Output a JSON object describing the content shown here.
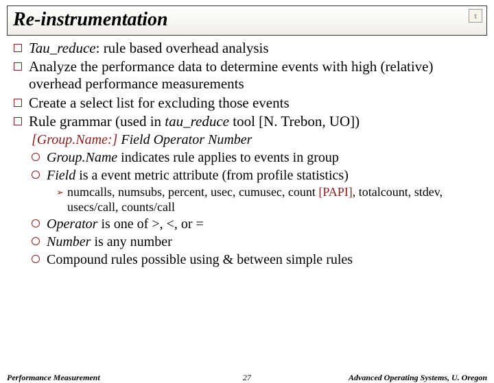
{
  "title": "Re-instrumentation",
  "logo_glyph": "τ",
  "bullets": [
    {
      "pre_italic": "Tau_reduce",
      "post": ": rule based overhead analysis"
    },
    {
      "text": "Analyze the performance data to determine events with high (relative) overhead performance measurements"
    },
    {
      "text": "Create a select list for excluding those events"
    },
    {
      "pre": "Rule grammar (used in ",
      "mid_italic": "tau_reduce",
      "post": " tool [N. Trebon, UO])"
    }
  ],
  "grammar": {
    "line": "[Group.Name:] Field Operator Number",
    "group_prefix": "[Group.Name:] "
  },
  "sub": [
    {
      "lead_italic": "Group.Name",
      "rest": " indicates rule applies to events in group"
    },
    {
      "lead_italic": "Field",
      "rest": " is a event metric attribute (from profile statistics)"
    }
  ],
  "metrics": {
    "line1_a": "numcalls, numsubs, percent, usec, cumusec, count ",
    "line1_b": "[PAPI]",
    "line1_c": ", totalcount, stdev, usecs/call, counts/call"
  },
  "sub2": [
    {
      "lead_italic": "Operator",
      "rest": " is one of >, <, or ="
    },
    {
      "lead_italic": "Number",
      "rest": " is any number"
    },
    {
      "text": "Compound rules possible using & between simple rules"
    }
  ],
  "footer": {
    "left": "Performance Measurement",
    "center": "27",
    "right": "Advanced Operating Systems, U. Oregon"
  }
}
